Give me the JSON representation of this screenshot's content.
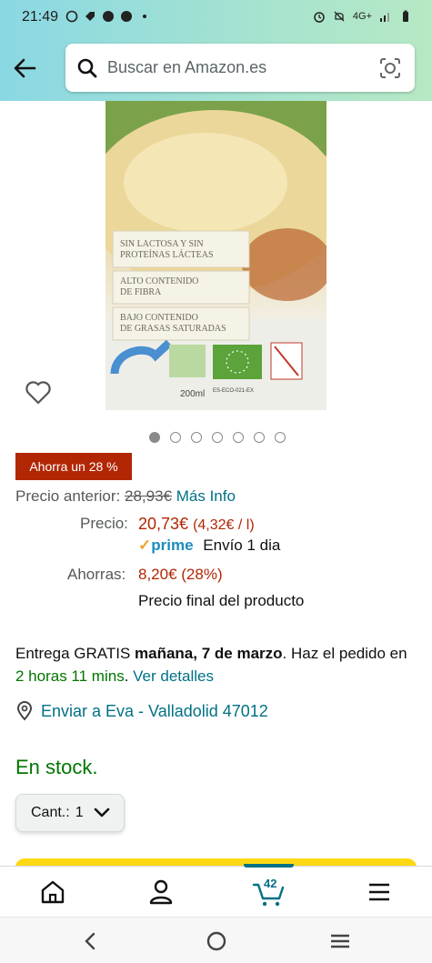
{
  "status_bar": {
    "time": "21:49",
    "network": "4G+"
  },
  "search": {
    "placeholder": "Buscar en Amazon.es"
  },
  "product_image": {
    "claims": [
      "Sin Lactosa y Sin Proteínas Lácteas",
      "Alto contenido de Fibra",
      "Bajo contenido de Grasas Saturadas"
    ],
    "volume": "200ml",
    "code": "ES-ECO-021-EX"
  },
  "carousel": {
    "total": 7,
    "active_index": 0
  },
  "deal_badge": "Ahorra un 28 %",
  "pricing": {
    "previous_label": "Precio anterior:",
    "previous_value": "28,93€",
    "more_info": "Más Info",
    "price_label": "Precio:",
    "price_value": "20,73€",
    "unit_price": "(4,32€ / l)",
    "prime_label": "prime",
    "prime_shipping": "Envío 1 dia",
    "savings_label": "Ahorras:",
    "savings_value": "8,20€ (28%)",
    "final_note": "Precio final del producto"
  },
  "delivery": {
    "prefix": "Entrega GRATIS ",
    "date": "mañana, 7 de marzo",
    "middle": ". Haz el pedido en ",
    "countdown": "2 horas 11 mins",
    "dot": ". ",
    "details": "Ver detalles"
  },
  "location": "Enviar a Eva - Valladolid 47012",
  "stock": "En stock.",
  "quantity": {
    "label": "Cant.:",
    "value": "1"
  },
  "bottom_nav": {
    "cart_count": "42",
    "items": [
      "home-icon",
      "account-icon",
      "cart-icon",
      "menu-icon"
    ]
  },
  "colors": {
    "accent": "#007185",
    "price": "#b12704",
    "stock": "#007600",
    "button": "#ffd814"
  }
}
